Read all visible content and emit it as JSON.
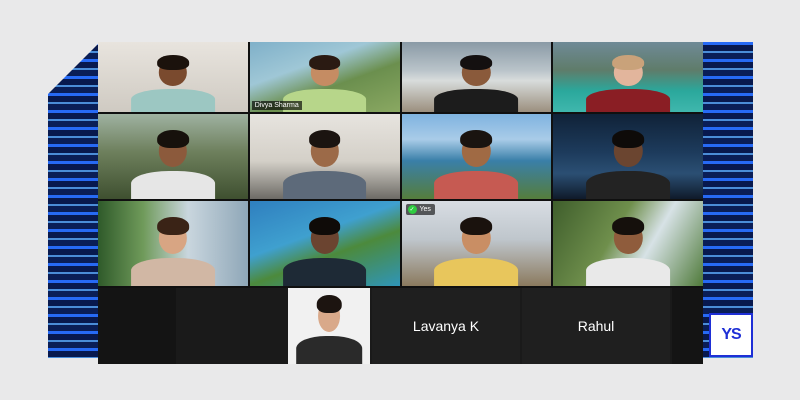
{
  "participants": [
    {
      "name_tag": ""
    },
    {
      "name_tag": "Divya Sharma"
    },
    {
      "name_tag": ""
    },
    {
      "name_tag": ""
    },
    {
      "name_tag": ""
    },
    {
      "name_tag": ""
    },
    {
      "name_tag": ""
    },
    {
      "name_tag": ""
    },
    {
      "name_tag": ""
    },
    {
      "name_tag": ""
    },
    {
      "name_tag": "",
      "reaction": "Yes"
    },
    {
      "name_tag": ""
    }
  ],
  "bottom_row": {
    "name_1": "Lavanya K",
    "name_2": "Rahul"
  },
  "logo": {
    "text": "YS"
  },
  "colors": {
    "accent": "#1e2fd6",
    "yes_check": "#2ecc40"
  }
}
